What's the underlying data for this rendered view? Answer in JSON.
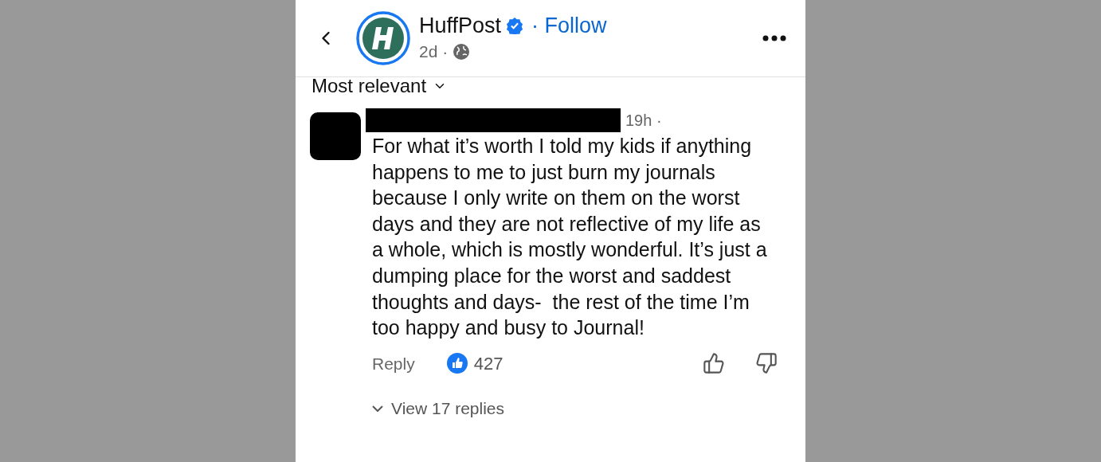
{
  "header": {
    "page_name": "HuffPost",
    "verified": true,
    "follow": "· Follow",
    "time": "2d ·"
  },
  "sort": {
    "label": "Most relevant"
  },
  "comment": {
    "time": "19h ·",
    "text": "For what it’s worth I told my kids if anything happens to me to just burn my journals because I only write on them on the worst days and they are not reflective of my life as a whole, which is mostly wonderful. It’s just a dumping place for the worst and saddest thoughts and days-  the rest of the time I’m too happy and busy to Journal!",
    "reply": "Reply",
    "likes": "427",
    "view_replies": "View 17 replies"
  }
}
